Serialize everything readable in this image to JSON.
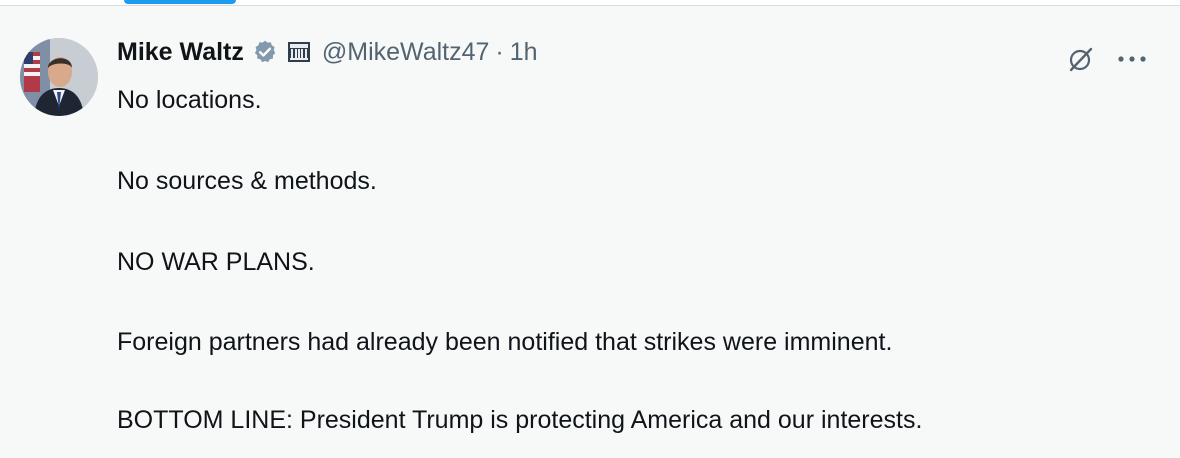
{
  "tweet": {
    "author": {
      "display_name": "Mike Waltz",
      "handle": "@MikeWaltz47",
      "verified_icon": "verified-badge-icon",
      "affiliation_icon": "government-building-icon"
    },
    "separator": "·",
    "time": "1h",
    "actions": {
      "grok_icon": "grok-icon",
      "more_icon": "more-options-icon",
      "more_label": "···"
    },
    "lines": [
      "No locations.",
      "No sources & methods.",
      "NO WAR PLANS.",
      "Foreign partners had already been notified that strikes were imminent.",
      "BOTTOM LINE:  President Trump is protecting America and our interests."
    ]
  },
  "colors": {
    "background": "#f7f9f9",
    "text": "#0f1419",
    "secondary_text": "#536471",
    "verified_badge": "#829aab",
    "accent": "#1d9bf0"
  }
}
